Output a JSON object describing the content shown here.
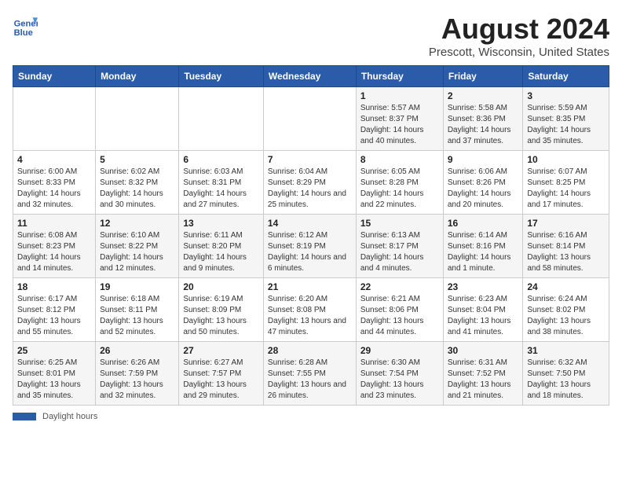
{
  "header": {
    "logo_line1": "General",
    "logo_line2": "Blue",
    "month": "August 2024",
    "location": "Prescott, Wisconsin, United States"
  },
  "days_of_week": [
    "Sunday",
    "Monday",
    "Tuesday",
    "Wednesday",
    "Thursday",
    "Friday",
    "Saturday"
  ],
  "weeks": [
    [
      {
        "day": "",
        "info": ""
      },
      {
        "day": "",
        "info": ""
      },
      {
        "day": "",
        "info": ""
      },
      {
        "day": "",
        "info": ""
      },
      {
        "day": "1",
        "info": "Sunrise: 5:57 AM\nSunset: 8:37 PM\nDaylight: 14 hours and 40 minutes."
      },
      {
        "day": "2",
        "info": "Sunrise: 5:58 AM\nSunset: 8:36 PM\nDaylight: 14 hours and 37 minutes."
      },
      {
        "day": "3",
        "info": "Sunrise: 5:59 AM\nSunset: 8:35 PM\nDaylight: 14 hours and 35 minutes."
      }
    ],
    [
      {
        "day": "4",
        "info": "Sunrise: 6:00 AM\nSunset: 8:33 PM\nDaylight: 14 hours and 32 minutes."
      },
      {
        "day": "5",
        "info": "Sunrise: 6:02 AM\nSunset: 8:32 PM\nDaylight: 14 hours and 30 minutes."
      },
      {
        "day": "6",
        "info": "Sunrise: 6:03 AM\nSunset: 8:31 PM\nDaylight: 14 hours and 27 minutes."
      },
      {
        "day": "7",
        "info": "Sunrise: 6:04 AM\nSunset: 8:29 PM\nDaylight: 14 hours and 25 minutes."
      },
      {
        "day": "8",
        "info": "Sunrise: 6:05 AM\nSunset: 8:28 PM\nDaylight: 14 hours and 22 minutes."
      },
      {
        "day": "9",
        "info": "Sunrise: 6:06 AM\nSunset: 8:26 PM\nDaylight: 14 hours and 20 minutes."
      },
      {
        "day": "10",
        "info": "Sunrise: 6:07 AM\nSunset: 8:25 PM\nDaylight: 14 hours and 17 minutes."
      }
    ],
    [
      {
        "day": "11",
        "info": "Sunrise: 6:08 AM\nSunset: 8:23 PM\nDaylight: 14 hours and 14 minutes."
      },
      {
        "day": "12",
        "info": "Sunrise: 6:10 AM\nSunset: 8:22 PM\nDaylight: 14 hours and 12 minutes."
      },
      {
        "day": "13",
        "info": "Sunrise: 6:11 AM\nSunset: 8:20 PM\nDaylight: 14 hours and 9 minutes."
      },
      {
        "day": "14",
        "info": "Sunrise: 6:12 AM\nSunset: 8:19 PM\nDaylight: 14 hours and 6 minutes."
      },
      {
        "day": "15",
        "info": "Sunrise: 6:13 AM\nSunset: 8:17 PM\nDaylight: 14 hours and 4 minutes."
      },
      {
        "day": "16",
        "info": "Sunrise: 6:14 AM\nSunset: 8:16 PM\nDaylight: 14 hours and 1 minute."
      },
      {
        "day": "17",
        "info": "Sunrise: 6:16 AM\nSunset: 8:14 PM\nDaylight: 13 hours and 58 minutes."
      }
    ],
    [
      {
        "day": "18",
        "info": "Sunrise: 6:17 AM\nSunset: 8:12 PM\nDaylight: 13 hours and 55 minutes."
      },
      {
        "day": "19",
        "info": "Sunrise: 6:18 AM\nSunset: 8:11 PM\nDaylight: 13 hours and 52 minutes."
      },
      {
        "day": "20",
        "info": "Sunrise: 6:19 AM\nSunset: 8:09 PM\nDaylight: 13 hours and 50 minutes."
      },
      {
        "day": "21",
        "info": "Sunrise: 6:20 AM\nSunset: 8:08 PM\nDaylight: 13 hours and 47 minutes."
      },
      {
        "day": "22",
        "info": "Sunrise: 6:21 AM\nSunset: 8:06 PM\nDaylight: 13 hours and 44 minutes."
      },
      {
        "day": "23",
        "info": "Sunrise: 6:23 AM\nSunset: 8:04 PM\nDaylight: 13 hours and 41 minutes."
      },
      {
        "day": "24",
        "info": "Sunrise: 6:24 AM\nSunset: 8:02 PM\nDaylight: 13 hours and 38 minutes."
      }
    ],
    [
      {
        "day": "25",
        "info": "Sunrise: 6:25 AM\nSunset: 8:01 PM\nDaylight: 13 hours and 35 minutes."
      },
      {
        "day": "26",
        "info": "Sunrise: 6:26 AM\nSunset: 7:59 PM\nDaylight: 13 hours and 32 minutes."
      },
      {
        "day": "27",
        "info": "Sunrise: 6:27 AM\nSunset: 7:57 PM\nDaylight: 13 hours and 29 minutes."
      },
      {
        "day": "28",
        "info": "Sunrise: 6:28 AM\nSunset: 7:55 PM\nDaylight: 13 hours and 26 minutes."
      },
      {
        "day": "29",
        "info": "Sunrise: 6:30 AM\nSunset: 7:54 PM\nDaylight: 13 hours and 23 minutes."
      },
      {
        "day": "30",
        "info": "Sunrise: 6:31 AM\nSunset: 7:52 PM\nDaylight: 13 hours and 21 minutes."
      },
      {
        "day": "31",
        "info": "Sunrise: 6:32 AM\nSunset: 7:50 PM\nDaylight: 13 hours and 18 minutes."
      }
    ]
  ],
  "footer": {
    "note": "Daylight hours"
  }
}
